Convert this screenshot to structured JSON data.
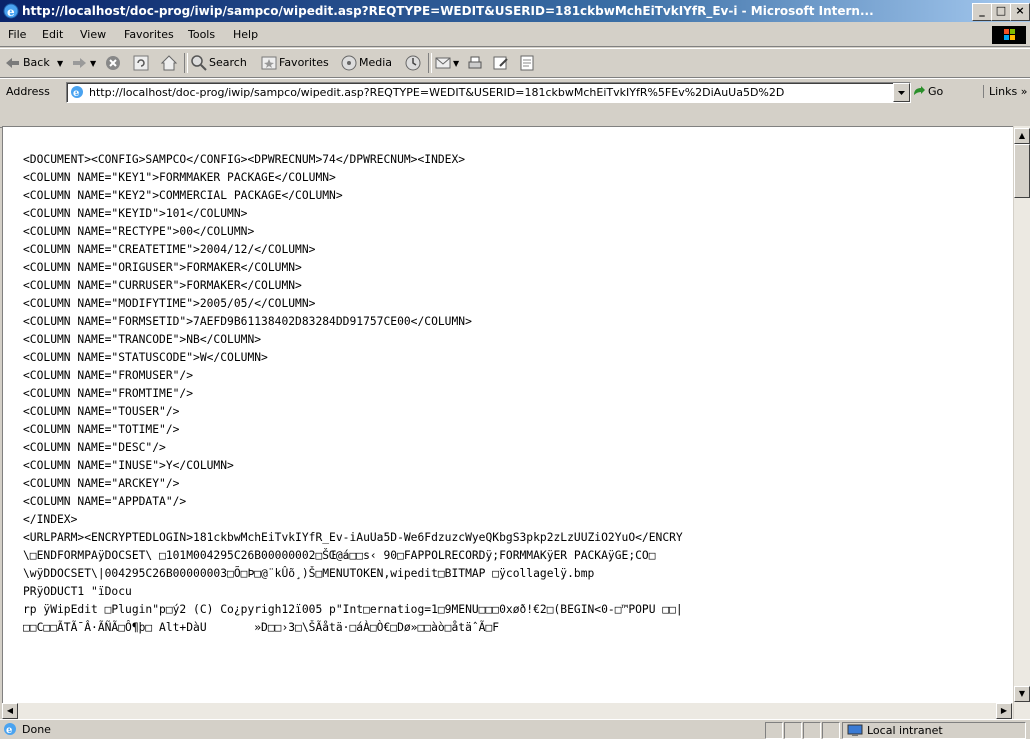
{
  "window": {
    "title": "http://localhost/doc-prog/iwip/sampco/wipedit.asp?REQTYPE=WEDIT&USERID=181ckbwMchEiTvkIYfR_Ev-i - Microsoft Intern...",
    "controls": [
      "_",
      "□",
      "×"
    ]
  },
  "menu": [
    "File",
    "Edit",
    "View",
    "Favorites",
    "Tools",
    "Help"
  ],
  "toolbar": {
    "back": "Back",
    "search": "Search",
    "favorites": "Favorites",
    "media": "Media"
  },
  "address": {
    "label": "Address",
    "url": "http://localhost/doc-prog/iwip/sampco/wipedit.asp?REQTYPE=WEDIT&USERID=181ckbwMchEiTvkIYfR%5FEv%2DiAuUa5D%2D",
    "go": "Go",
    "links": "Links »"
  },
  "document_lines": [
    "<DOCUMENT><CONFIG>SAMPCO</CONFIG><DPWRECNUM>74</DPWRECNUM><INDEX>",
    "<COLUMN NAME=\"KEY1\">FORMMAKER PACKAGE</COLUMN>",
    "<COLUMN NAME=\"KEY2\">COMMERCIAL PACKAGE</COLUMN>",
    "<COLUMN NAME=\"KEYID\">101</COLUMN>",
    "<COLUMN NAME=\"RECTYPE\">00</COLUMN>",
    "<COLUMN NAME=\"CREATETIME\">2004/12/</COLUMN>",
    "<COLUMN NAME=\"ORIGUSER\">FORMAKER</COLUMN>",
    "<COLUMN NAME=\"CURRUSER\">FORMAKER</COLUMN>",
    "<COLUMN NAME=\"MODIFYTIME\">2005/05/</COLUMN>",
    "<COLUMN NAME=\"FORMSETID\">7AEFD9B61138402D83284DD91757CE00</COLUMN>",
    "<COLUMN NAME=\"TRANCODE\">NB</COLUMN>",
    "<COLUMN NAME=\"STATUSCODE\">W</COLUMN>",
    "<COLUMN NAME=\"FROMUSER\"/>",
    "<COLUMN NAME=\"FROMTIME\"/>",
    "<COLUMN NAME=\"TOUSER\"/>",
    "<COLUMN NAME=\"TOTIME\"/>",
    "<COLUMN NAME=\"DESC\"/>",
    "<COLUMN NAME=\"INUSE\">Y</COLUMN>",
    "<COLUMN NAME=\"ARCKEY\"/>",
    "<COLUMN NAME=\"APPDATA\"/>",
    "</INDEX>",
    "<URLPARM><ENCRYPTEDLOGIN>181ckbwMchEiTvkIYfR_Ev-iAuUa5D-We6FdzuzcWyeQKbgS3pkp2zLzUUZiO2YuO</ENCRY",
    "\\□ENDFORMPAÿDOCSET\\ □101M004295C26B00000002□ŠŒ@á□□s‹ 90□FAPPOLRECORDÿ;FORMMAKÿER PACKAÿGE;CO□",
    "\\wÿDDOCSET\\|004295C26B00000003□Õ□Þ□@¨kÛõ¸)Š□MENUTOKEN,wipedit□BITMAP □ÿcollagelÿ.bmp",
    "PRÿODUCT1 \"ïDocu",
    "rp ÿWipEdit □Plugin\"p□ý2 (C) Co¿pyrigh12ï005 p\"Int□ernatiog=1□9MENU□□□0xøð!€2□(BEGIN<0-□™POPU □□|",
    "□□C□□ÃTÃ¯Â·ÃÑÃ□Ô¶þ□ Alt+DàU       »D□□›3□\\ŠÃåtä·□áÀ□Ò€□Dø»□□àò□åtäˆÃ□F"
  ],
  "status": {
    "text": "Done",
    "zone": "Local intranet"
  }
}
